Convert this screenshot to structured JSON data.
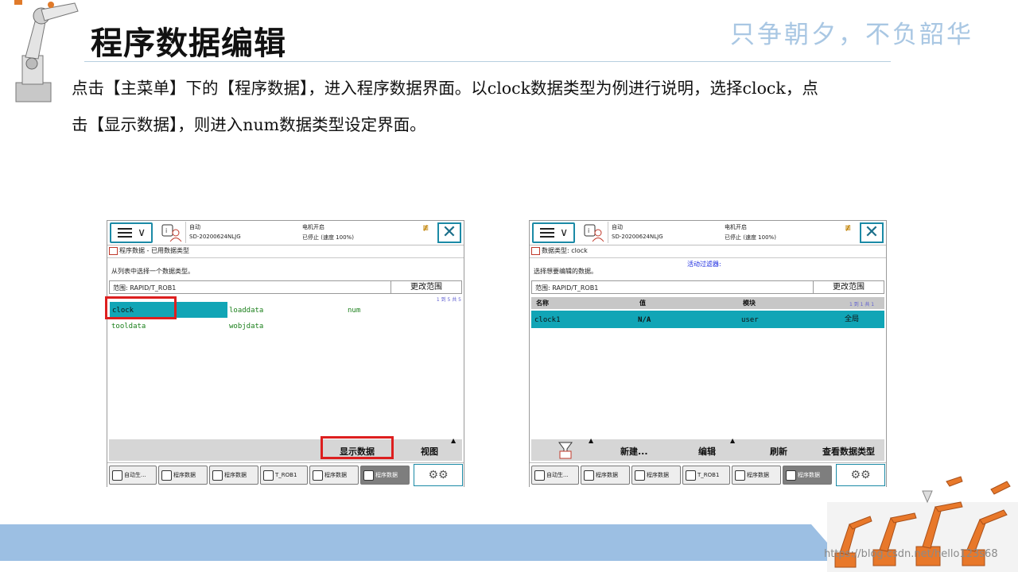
{
  "slide": {
    "title": "程序数据编辑",
    "slogan": "只争朝夕，不负韶华",
    "description_line1": "点击【主菜单】下的【程序数据】，进入程序数据界面。以clock数据类型为例进行说明，选择clock，点",
    "description_line2": "击【显示数据】，则进入num数据类型设定界面。",
    "watermark": "https://blog.csdn.net/hello123s68"
  },
  "left_screen": {
    "status": {
      "mode": "自动",
      "controller": "SD-20200624NLJG",
      "motor": "电机开启",
      "state": "已停止 (速度 100%)"
    },
    "breadcrumb": "程序数据 - 已用数据类型",
    "prompt": "从列表中选择一个数据类型。",
    "scope_label": "范围: RAPID/T_ROB1",
    "scope_button": "更改范围",
    "page_count": "1 到 5 共 5",
    "types": [
      "clock",
      "loaddata",
      "num",
      "tooldata",
      "wobjdata"
    ],
    "selected_type": "clock",
    "commands": {
      "show_data": "显示数据",
      "view": "视图"
    }
  },
  "right_screen": {
    "status": {
      "mode": "自动",
      "controller": "SD-20200624NLJG",
      "motor": "电机开启",
      "state": "已停止 (速度 100%)"
    },
    "breadcrumb": "数据类型: clock",
    "filter_label": "活动过滤器:",
    "prompt": "选择想要编辑的数据。",
    "scope_label": "范围: RAPID/T_ROB1",
    "scope_button": "更改范围",
    "columns": [
      "名称",
      "值",
      "模块"
    ],
    "page_count": "1 到 1 共 1",
    "row": {
      "name": "clock1",
      "value": "N/A",
      "module": "user",
      "scope": "全局"
    },
    "commands": {
      "new": "新建...",
      "edit": "编辑",
      "refresh": "刷新",
      "view_type": "查看数据类型"
    }
  },
  "taskbar": [
    "自动生...",
    "程序数据",
    "程序数据",
    "T_ROB1",
    "程序数据",
    "程序数据"
  ]
}
